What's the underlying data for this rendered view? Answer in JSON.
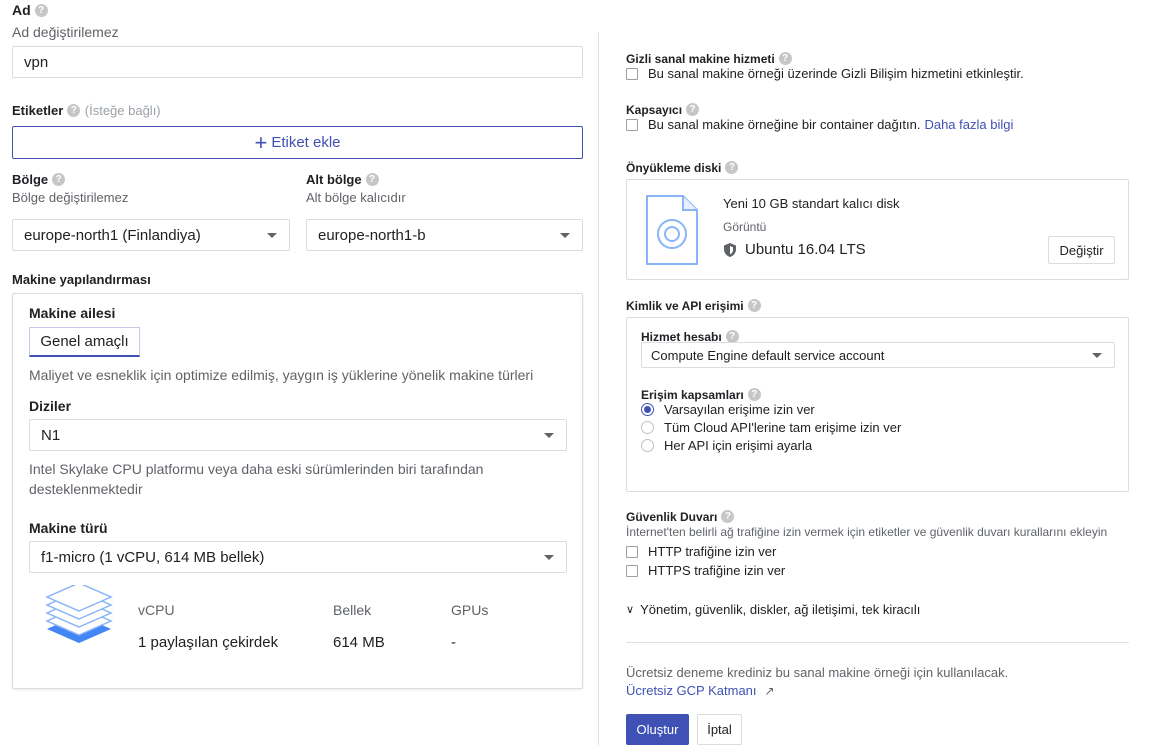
{
  "name": {
    "label": "Ad",
    "sublabel": "Ad değiştirilemez",
    "value": "vpn"
  },
  "labels": {
    "label": "Etiketler",
    "optional": "(İsteğe bağlı)",
    "add_button": "Etiket ekle"
  },
  "region": {
    "label": "Bölge",
    "sublabel": "Bölge değiştirilemez",
    "value": "europe-north1 (Finlandiya)"
  },
  "zone": {
    "label": "Alt bölge",
    "sublabel": "Alt bölge kalıcıdır",
    "value": "europe-north1-b"
  },
  "machine_config": {
    "title": "Makine yapılandırması",
    "family_label": "Makine ailesi",
    "family_tab": "Genel amaçlı",
    "family_desc": "Maliyet ve esneklik için optimize edilmiş, yaygın iş yüklerine yönelik makine türleri",
    "series_label": "Diziler",
    "series_value": "N1",
    "series_desc_line1": "Intel Skylake CPU platformu veya daha eski sürümlerinden biri tarafından",
    "series_desc_line2": "desteklenmektedir",
    "type_label": "Makine türü",
    "type_value": "f1-micro (1 vCPU, 614 MB bellek)",
    "spec_headers": {
      "vcpu": "vCPU",
      "memory": "Bellek",
      "gpus": "GPUs"
    },
    "spec_values": {
      "vcpu": "1 paylaşılan çekirdek",
      "memory": "614 MB",
      "gpus": "-"
    }
  },
  "confidential": {
    "label": "Gizli sanal makine hizmeti",
    "checkbox": "Bu sanal makine örneği üzerinde Gizli Bilişim hizmetini etkinleştir."
  },
  "container": {
    "label": "Kapsayıcı",
    "checkbox": "Bu sanal makine örneğine bir container dağıtın.",
    "link": "Daha fazla bilgi"
  },
  "boot_disk": {
    "label": "Önyükleme diski",
    "title": "Yeni 10 GB standart kalıcı disk",
    "image_label": "Görüntü",
    "image": "Ubuntu 16.04 LTS",
    "change_button": "Değiştir"
  },
  "identity": {
    "label": "Kimlik ve API erişimi",
    "service_account_label": "Hizmet hesabı",
    "service_account_value": "Compute Engine default service account",
    "scopes_label": "Erişim kapsamları",
    "scopes": [
      {
        "label": "Varsayılan erişime izin ver",
        "selected": true
      },
      {
        "label": "Tüm Cloud API'lerine tam erişime izin ver",
        "selected": false
      },
      {
        "label": "Her API için erişimi ayarla",
        "selected": false
      }
    ]
  },
  "firewall": {
    "label": "Güvenlik Duvarı",
    "desc": "İnternet'ten belirli ağ trafiğine izin vermek için etiketler ve güvenlik duvarı kurallarını ekleyin",
    "http": "HTTP trafiğine izin ver",
    "https": "HTTPS trafiğine izin ver"
  },
  "advanced_link": "Yönetim, güvenlik, diskler, ağ iletişimi, tek kiracılı",
  "free_trial": {
    "text": "Ücretsiz deneme krediniz bu sanal makine örneği için kullanılacak.",
    "link": "Ücretsiz GCP Katmanı"
  },
  "actions": {
    "create": "Oluştur",
    "cancel": "İptal"
  },
  "colors": {
    "accent": "#3f51b5",
    "border": "#dadce0",
    "muted": "#5f6368"
  }
}
